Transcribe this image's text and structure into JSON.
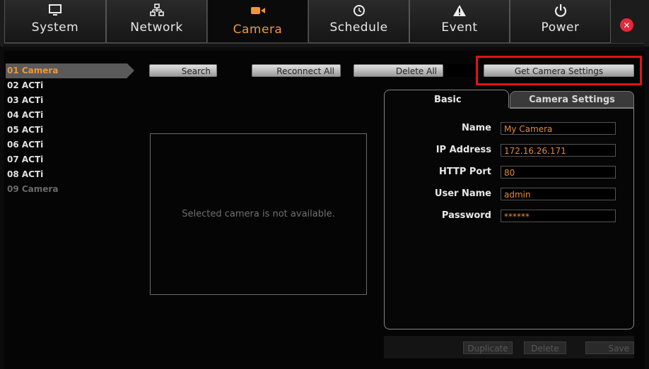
{
  "nav": {
    "tabs": [
      {
        "id": "system",
        "label": "System",
        "icon": "monitor-icon"
      },
      {
        "id": "network",
        "label": "Network",
        "icon": "network-icon"
      },
      {
        "id": "camera",
        "label": "Camera",
        "icon": "camera-icon",
        "active": true
      },
      {
        "id": "schedule",
        "label": "Schedule",
        "icon": "clock-icon"
      },
      {
        "id": "event",
        "label": "Event",
        "icon": "warning-icon"
      },
      {
        "id": "power",
        "label": "Power",
        "icon": "power-icon"
      }
    ],
    "close_glyph": "✕"
  },
  "cameras": [
    {
      "label": "01 Camera",
      "state": "selected"
    },
    {
      "label": "02 ACTi",
      "state": "normal"
    },
    {
      "label": "03 ACTi",
      "state": "normal"
    },
    {
      "label": "04 ACTi",
      "state": "normal"
    },
    {
      "label": "05 ACTi",
      "state": "normal"
    },
    {
      "label": "06 ACTi",
      "state": "normal"
    },
    {
      "label": "07 ACTi",
      "state": "normal"
    },
    {
      "label": "08 ACTi",
      "state": "normal"
    },
    {
      "label": "09 Camera",
      "state": "disabled"
    }
  ],
  "toolbar": {
    "search": "Search",
    "reconnect_all": "Reconnect All",
    "delete_all": "Delete All",
    "get_camera_settings": "Get Camera Settings"
  },
  "preview": {
    "message": "Selected camera is not available."
  },
  "settings": {
    "tabs": {
      "basic": "Basic",
      "camera_settings": "Camera Settings"
    },
    "fields": [
      {
        "label": "Name",
        "value": "My Camera"
      },
      {
        "label": "IP Address",
        "value": "172.16.26.171"
      },
      {
        "label": "HTTP Port",
        "value": "80"
      },
      {
        "label": "User Name",
        "value": "admin"
      },
      {
        "label": "Password",
        "value": "******"
      }
    ],
    "buttons": {
      "duplicate": "Duplicate",
      "delete": "Delete",
      "save": "Save"
    }
  },
  "colors": {
    "accent": "#f0963a",
    "highlight": "#e11313",
    "close": "#e6283c"
  }
}
